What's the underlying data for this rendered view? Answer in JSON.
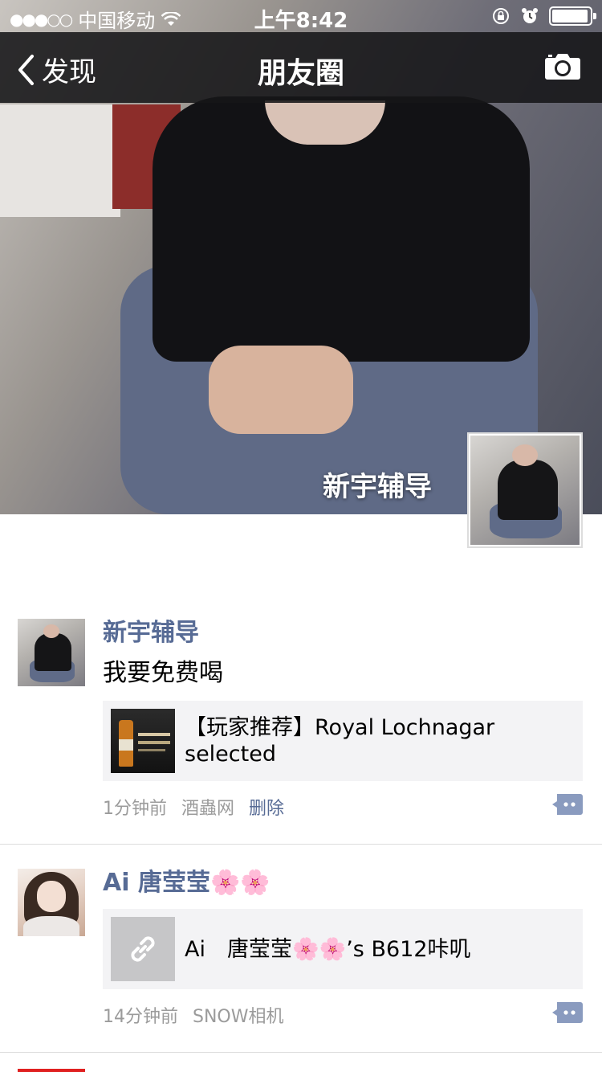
{
  "status_bar": {
    "carrier": "中国移动",
    "time": "上午8:42",
    "battery_level": 0.95
  },
  "nav": {
    "back_label": "发现",
    "title": "朋友圈",
    "camera_icon": "camera-icon"
  },
  "profile": {
    "name": "新宇辅导"
  },
  "posts": [
    {
      "name": "新宇辅导",
      "text": "我要免费喝",
      "link": {
        "title": "【玩家推荐】Royal Lochnagar selected"
      },
      "time": "1分钟前",
      "source": "酒蟲网",
      "delete_label": "删除"
    },
    {
      "name": "Ai 唐莹莹🌸🌸",
      "link": {
        "title": "Ai　唐莹莹🌸🌸’s B612咔叽"
      },
      "time": "14分钟前",
      "source": "SNOW相机"
    }
  ],
  "colors": {
    "link_blue": "#576b95",
    "meta_gray": "#9b9b9b",
    "card_bg": "#f3f3f5"
  }
}
